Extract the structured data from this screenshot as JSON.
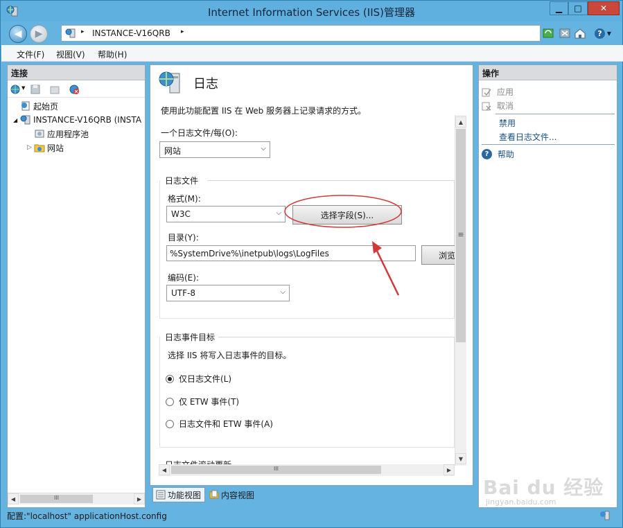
{
  "window": {
    "title": "Internet Information Services (IIS)管理器",
    "minimize": "▁",
    "maximize": "□",
    "close": "✕"
  },
  "nav": {
    "path": "INSTANCE-V16QRB",
    "sep": "▸",
    "help": "?"
  },
  "menu": {
    "file": "文件(F)",
    "view": "视图(V)",
    "help": "帮助(H)"
  },
  "connections": {
    "header": "连接",
    "tree": [
      {
        "label": "起始页",
        "expander": ""
      },
      {
        "label": "INSTANCE-V16QRB (INSTA",
        "expander": "◢"
      },
      {
        "label": "应用程序池",
        "expander": ""
      },
      {
        "label": "网站",
        "expander": "▷"
      }
    ]
  },
  "feature": {
    "title": "日志",
    "description": "使用此功能配置 IIS 在 Web 服务器上记录请求的方式。",
    "one_log_label": "一个日志文件/每(O):",
    "one_log_value": "网站",
    "log_file_group": "日志文件",
    "format_label": "格式(M):",
    "format_value": "W3C",
    "select_fields_button": "选择字段(S)...",
    "directory_label": "目录(Y):",
    "directory_value": "%SystemDrive%\\inetpub\\logs\\LogFiles",
    "browse_button": "浏览",
    "encoding_label": "编码(E):",
    "encoding_value": "UTF-8",
    "event_group": "日志事件目标",
    "event_description": "选择 IIS 将写入日志事件的目标。",
    "radio_log_only": "仅日志文件(L)",
    "radio_etw_only": "仅 ETW 事件(T)",
    "radio_both": "日志文件和 ETW 事件(A)",
    "rollover_group": "日志文件滚动更新",
    "hscroll_grip": "III",
    "vscroll_grip": "≡"
  },
  "view_tabs": {
    "features": "功能视图",
    "content": "内容视图"
  },
  "actions": {
    "header": "操作",
    "apply": "应用",
    "cancel": "取消",
    "disable": "禁用",
    "view_log_files": "查看日志文件...",
    "help": "帮助"
  },
  "left_hscroll_grip": "III",
  "status": {
    "text": "配置:\"localhost\" applicationHost.config"
  },
  "watermark": {
    "brand": "Bai du 经验",
    "url": "jingyan.baidu.com"
  },
  "colors": {
    "window_frame": "#65b3e0",
    "link": "#1a4f8a",
    "annotation": "#d23a3a"
  }
}
